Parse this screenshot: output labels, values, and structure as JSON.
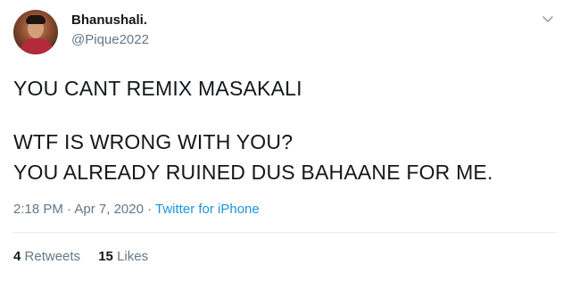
{
  "author": {
    "display_name": "Bhanushali.",
    "handle": "@Pique2022",
    "avatar_icon": "profile-photo"
  },
  "tweet": {
    "lines": [
      "YOU CANT REMIX MASAKALI",
      "WTF IS WRONG WITH YOU?",
      "YOU ALREADY RUINED DUS BAHAANE FOR ME."
    ],
    "time": "2:18 PM",
    "date": "Apr 7, 2020",
    "separator": " · ",
    "source": "Twitter for iPhone"
  },
  "stats": {
    "retweets_count": "4",
    "retweets_label": "Retweets",
    "likes_count": "15",
    "likes_label": "Likes"
  },
  "colors": {
    "text_primary": "#14171a",
    "text_secondary": "#657786",
    "link": "#1b95e0",
    "divider": "#e6ecf0"
  }
}
